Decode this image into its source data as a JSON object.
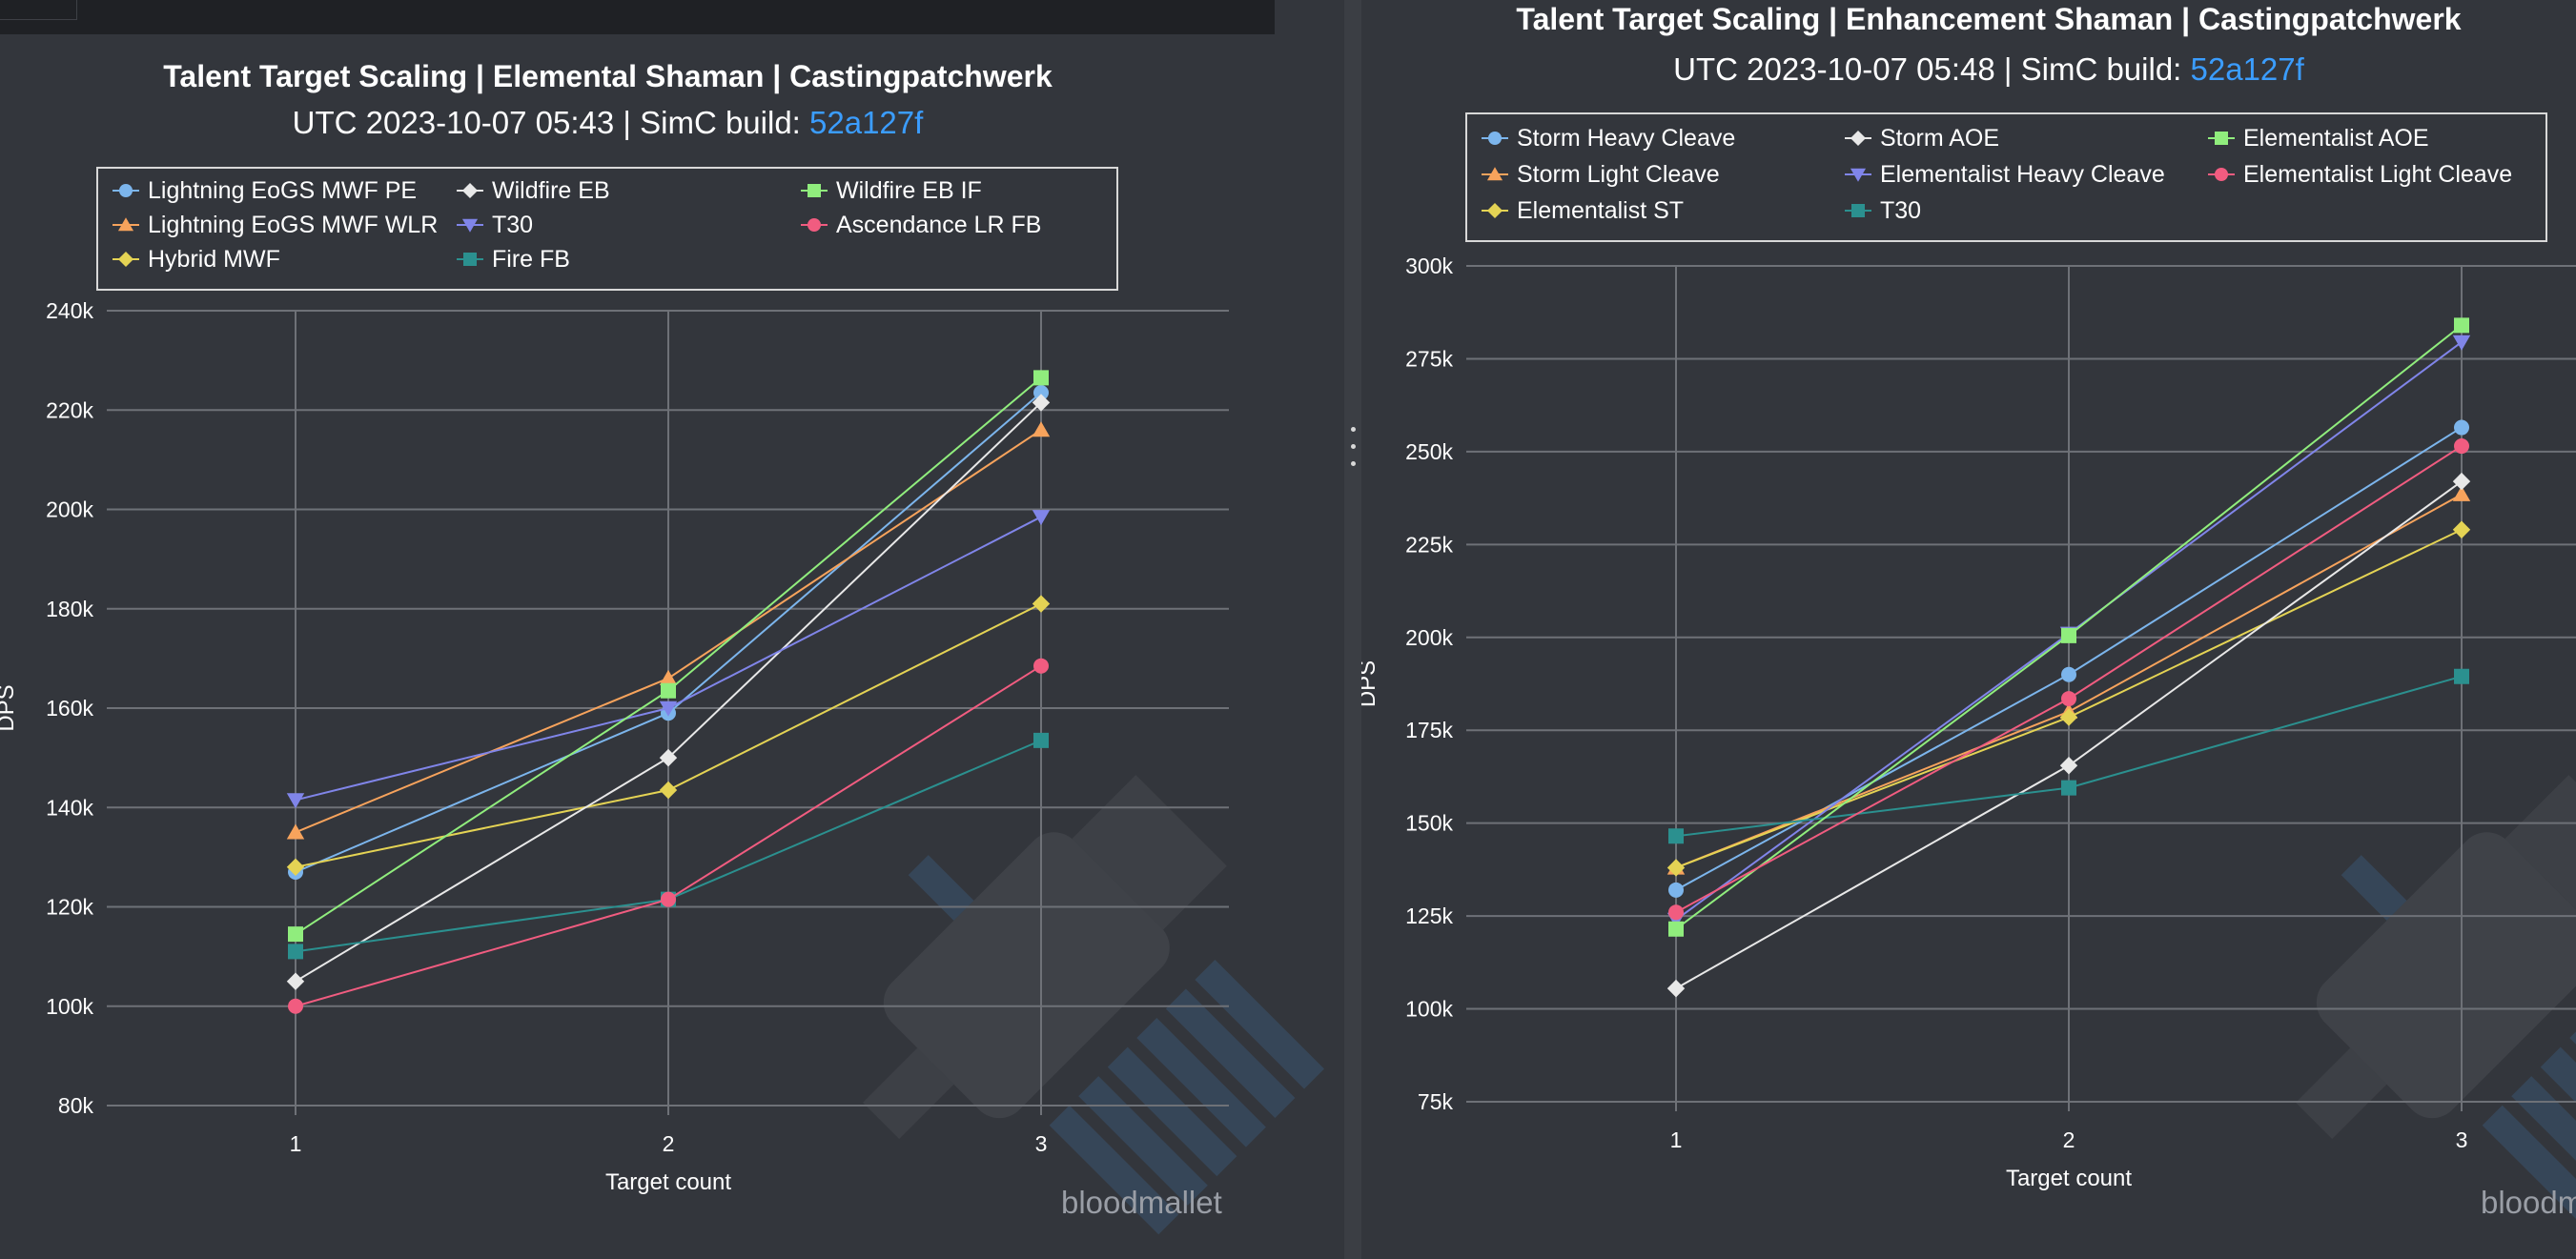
{
  "panels": {
    "left": {
      "title": "Talent Target Scaling | Elemental Shaman | Castingpatchwerk",
      "subtitle_prefix": "UTC 2023-10-07 05:43 | SimC build: ",
      "build": "52a127f",
      "credit": "bloodmallet"
    },
    "right": {
      "title": "Talent Target Scaling | Enhancement Shaman | Castingpatchwerk",
      "subtitle_prefix": "UTC 2023-10-07 05:48 | SimC build: ",
      "build": "52a127f",
      "credit": "bloodmallet"
    }
  },
  "chart_data": [
    {
      "type": "line",
      "title": "Talent Target Scaling | Elemental Shaman | Castingpatchwerk",
      "subtitle": "UTC 2023-10-07 05:43 | SimC build: 52a127f",
      "xlabel": "Target count",
      "ylabel": "DPS",
      "x": [
        1,
        2,
        3
      ],
      "ylim": [
        80000,
        240000
      ],
      "yticks": [
        80000,
        100000,
        120000,
        140000,
        160000,
        180000,
        200000,
        220000,
        240000
      ],
      "ytick_labels": [
        "80k",
        "100k",
        "120k",
        "140k",
        "160k",
        "180k",
        "200k",
        "220k",
        "240k"
      ],
      "grid": true,
      "legend_position": "top",
      "series": [
        {
          "name": "Lightning EoGS MWF PE",
          "color": "#7cb5ec",
          "marker": "circle",
          "values": [
            127000,
            159000,
            223500
          ]
        },
        {
          "name": "Lightning EoGS MWF WLR",
          "color": "#f7a35c",
          "marker": "triangle",
          "values": [
            135000,
            166000,
            216000
          ]
        },
        {
          "name": "Hybrid MWF",
          "color": "#e4d354",
          "marker": "diamond",
          "values": [
            128000,
            143500,
            181000
          ]
        },
        {
          "name": "Wildfire EB",
          "color": "#e8e8e8",
          "marker": "diamond",
          "values": [
            105000,
            150000,
            221500
          ]
        },
        {
          "name": "T30",
          "color": "#8085e9",
          "marker": "triangle-down",
          "values": [
            141500,
            160000,
            198500
          ]
        },
        {
          "name": "Fire FB",
          "color": "#2b908f",
          "marker": "square",
          "values": [
            111000,
            121500,
            153500
          ]
        },
        {
          "name": "Wildfire EB IF",
          "color": "#90ed7d",
          "marker": "square",
          "values": [
            114500,
            163500,
            226500
          ]
        },
        {
          "name": "Ascendance LR FB",
          "color": "#f15c80",
          "marker": "circle",
          "values": [
            100000,
            121500,
            168500
          ]
        }
      ]
    },
    {
      "type": "line",
      "title": "Talent Target Scaling | Enhancement Shaman | Castingpatchwerk",
      "subtitle": "UTC 2023-10-07 05:48 | SimC build: 52a127f",
      "xlabel": "Target count",
      "ylabel": "DPS",
      "x": [
        1,
        2,
        3
      ],
      "ylim": [
        75000,
        300000
      ],
      "yticks": [
        75000,
        100000,
        125000,
        150000,
        175000,
        200000,
        225000,
        250000,
        275000,
        300000
      ],
      "ytick_labels": [
        "75k",
        "100k",
        "125k",
        "150k",
        "175k",
        "200k",
        "225k",
        "250k",
        "275k",
        "300k"
      ],
      "grid": true,
      "legend_position": "top",
      "series": [
        {
          "name": "Storm Heavy Cleave",
          "color": "#7cb5ec",
          "marker": "circle",
          "values": [
            132000,
            190000,
            256500
          ]
        },
        {
          "name": "Storm Light Cleave",
          "color": "#f7a35c",
          "marker": "triangle",
          "values": [
            138000,
            180000,
            238500
          ]
        },
        {
          "name": "Elementalist ST",
          "color": "#e4d354",
          "marker": "diamond",
          "values": [
            138000,
            178500,
            229000
          ]
        },
        {
          "name": "Storm AOE",
          "color": "#e8e8e8",
          "marker": "diamond",
          "values": [
            105500,
            165500,
            242000
          ]
        },
        {
          "name": "Elementalist Heavy Cleave",
          "color": "#8085e9",
          "marker": "triangle-down",
          "values": [
            124000,
            201000,
            279500
          ]
        },
        {
          "name": "T30",
          "color": "#2b908f",
          "marker": "square",
          "values": [
            146500,
            159500,
            189500
          ]
        },
        {
          "name": "Elementalist AOE",
          "color": "#90ed7d",
          "marker": "square",
          "values": [
            121500,
            200500,
            284000
          ]
        },
        {
          "name": "Elementalist Light Cleave",
          "color": "#f15c80",
          "marker": "circle",
          "values": [
            126000,
            183500,
            251500
          ]
        }
      ]
    }
  ]
}
